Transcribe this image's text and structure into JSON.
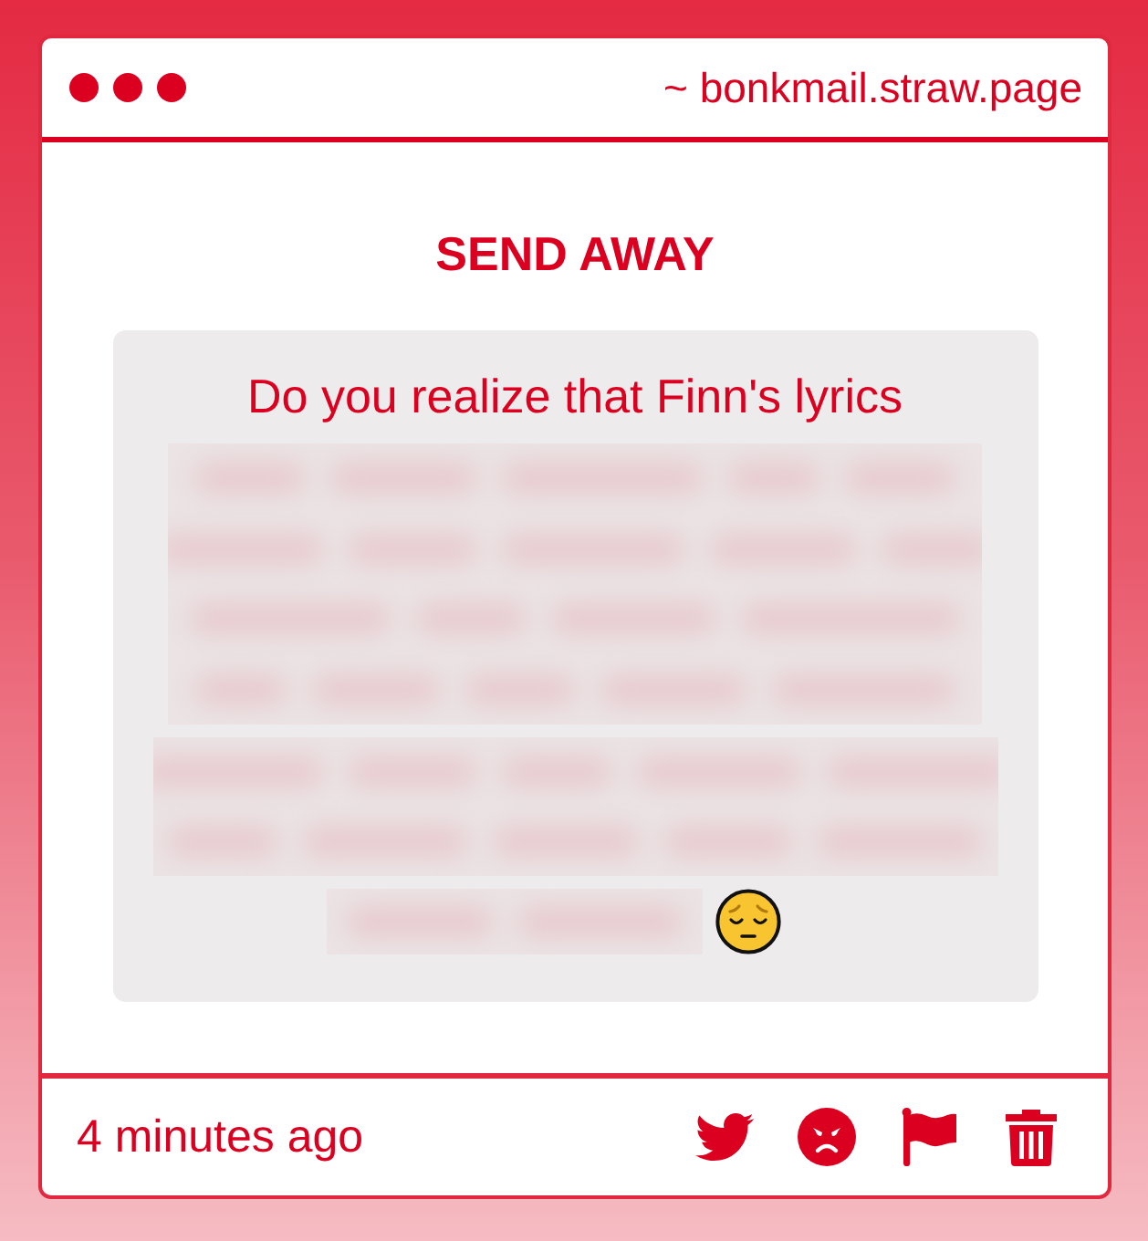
{
  "window": {
    "url": "~ bonkmail.straw.page"
  },
  "title": "SEND AWAY",
  "message": {
    "text": "Do you realize that Finn's lyrics"
  },
  "footer": {
    "time": "4 minutes ago"
  }
}
